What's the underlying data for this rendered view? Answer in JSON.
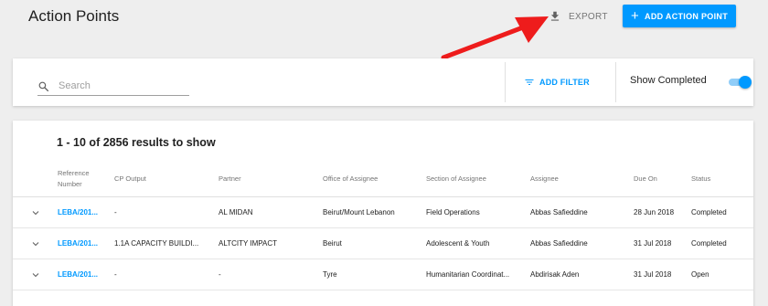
{
  "header": {
    "title": "Action Points",
    "export_label": "EXPORT",
    "add_label": "ADD ACTION POINT"
  },
  "filters": {
    "search_placeholder": "Search",
    "add_filter_label": "ADD FILTER",
    "show_completed_label": "Show Completed",
    "show_completed_on": true
  },
  "list": {
    "results_text": "1 - 10 of 2856 results to show",
    "columns": {
      "reference_line1": "Reference",
      "reference_line2": "Number",
      "cp_output": "CP Output",
      "partner": "Partner",
      "office": "Office of Assignee",
      "section": "Section of Assignee",
      "assignee": "Assignee",
      "due_on": "Due On",
      "status": "Status"
    },
    "rows": [
      {
        "reference": "LEBA/201...",
        "cp_output": "-",
        "partner": "AL MIDAN",
        "office": "Beirut/Mount Lebanon",
        "section": "Field Operations",
        "assignee": "Abbas Safieddine",
        "due_on": "28 Jun 2018",
        "status": "Completed"
      },
      {
        "reference": "LEBA/201...",
        "cp_output": "1.1A CAPACITY BUILDI...",
        "partner": "ALTCITY IMPACT",
        "office": "Beirut",
        "section": "Adolescent & Youth",
        "assignee": "Abbas Safieddine",
        "due_on": "31 Jul 2018",
        "status": "Completed"
      },
      {
        "reference": "LEBA/201...",
        "cp_output": "-",
        "partner": "-",
        "office": "Tyre",
        "section": "Humanitarian Coordinat...",
        "assignee": "Abdirisak Aden",
        "due_on": "31 Jul 2018",
        "status": "Open"
      }
    ]
  },
  "colors": {
    "accent": "#0099ff",
    "annotation_arrow": "#ee1c1c"
  },
  "icons": {
    "export": "download-icon",
    "add": "plus-icon",
    "search": "search-icon",
    "filter": "filter-list-icon",
    "expand": "chevron-down-icon"
  }
}
